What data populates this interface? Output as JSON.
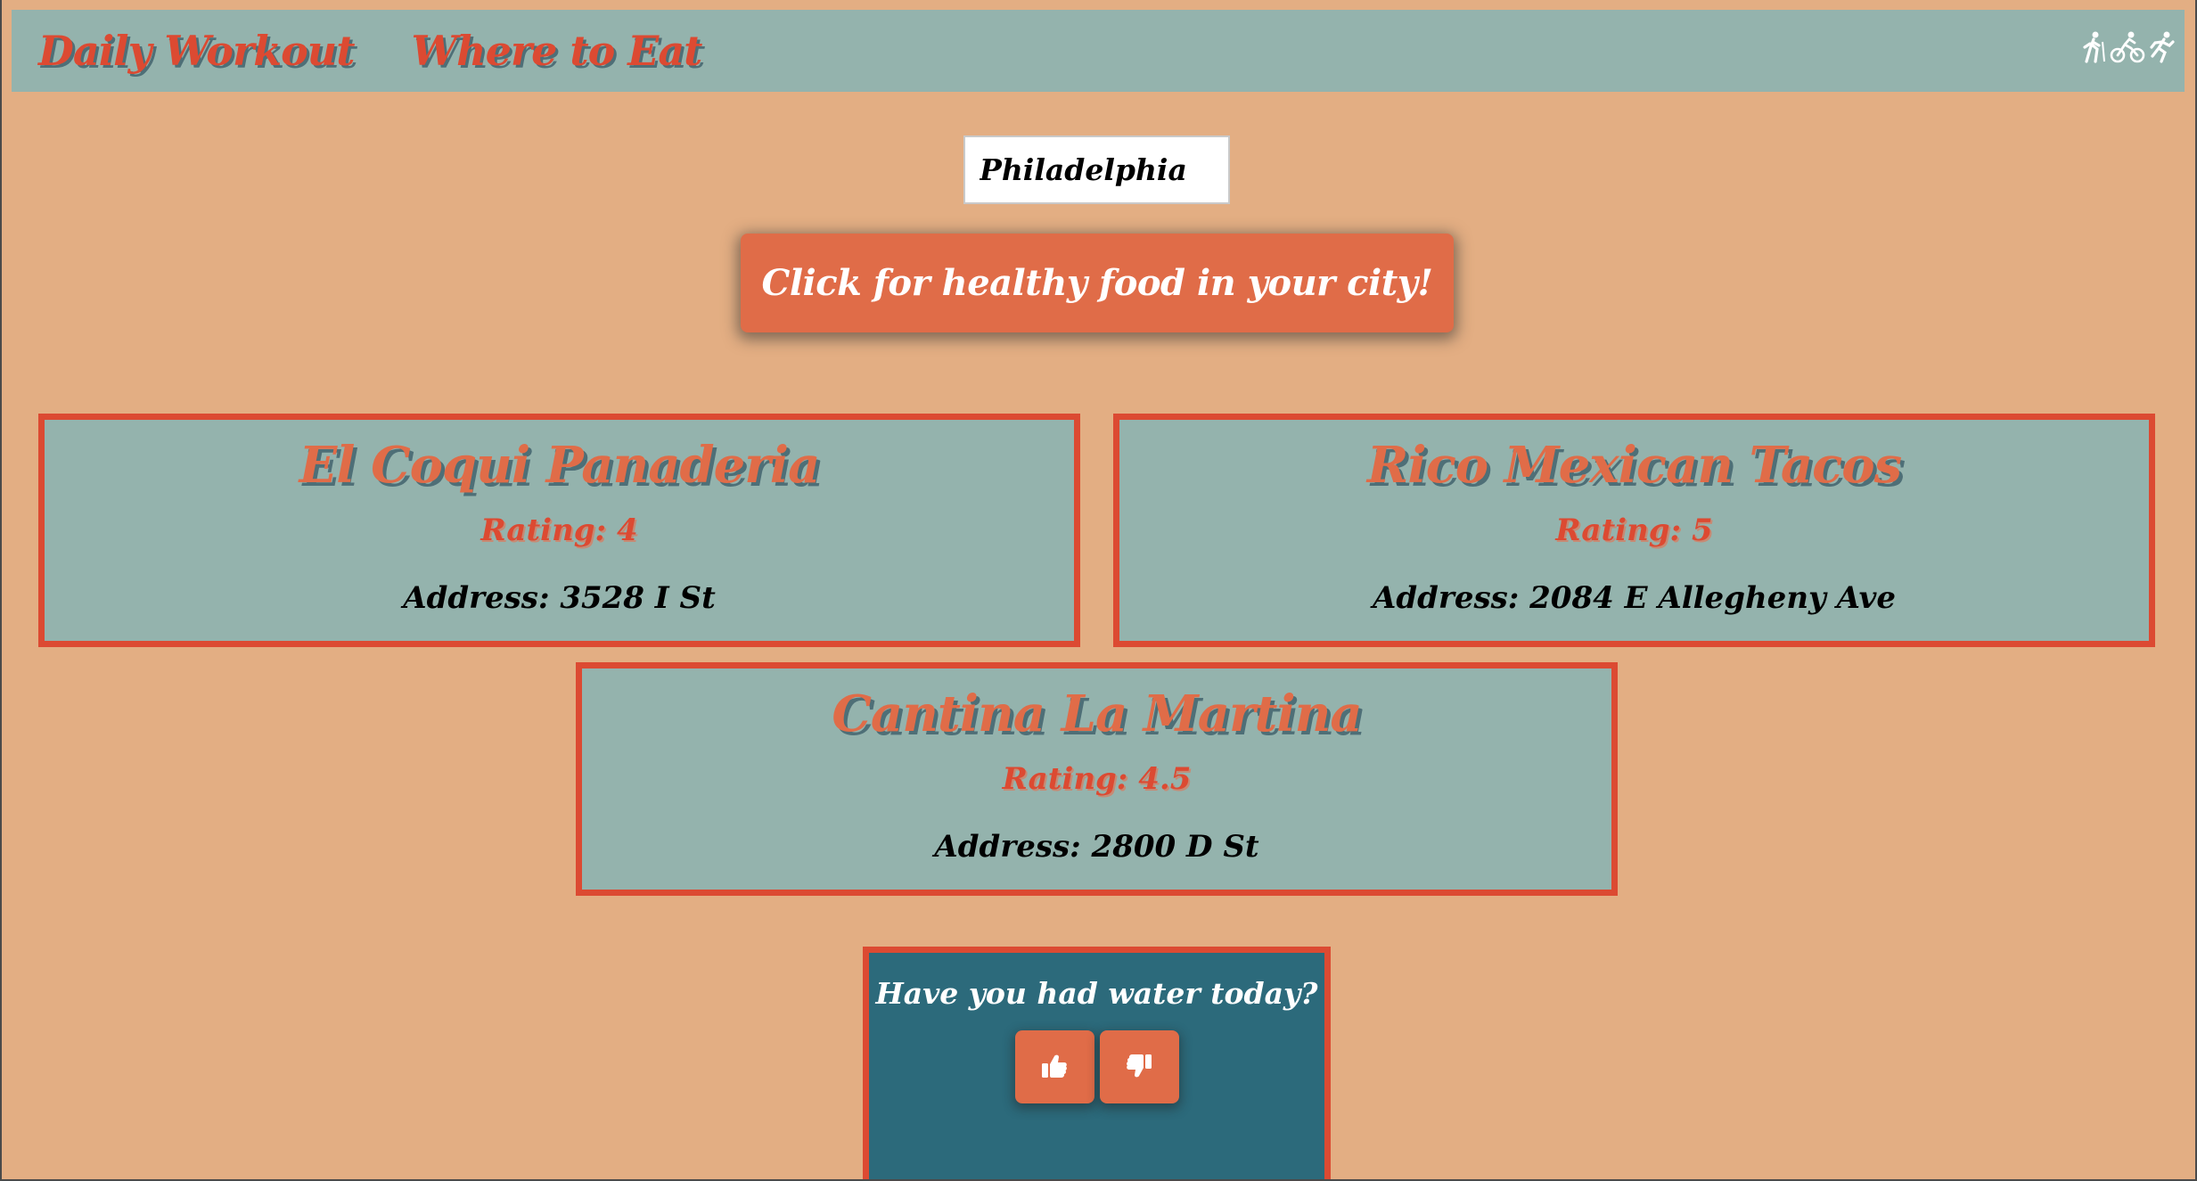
{
  "nav": {
    "links": [
      {
        "label": "Daily Workout"
      },
      {
        "label": "Where to Eat"
      }
    ],
    "icons": [
      "walking-icon",
      "biking-icon",
      "running-icon"
    ]
  },
  "search": {
    "city_value": "Philadelphia",
    "button_label": "Click for healthy food in your city!"
  },
  "restaurants": [
    {
      "name": "El Coqui Panaderia",
      "rating": "Rating: 4",
      "address": "Address: 3528 I St"
    },
    {
      "name": "Rico Mexican Tacos",
      "rating": "Rating: 5",
      "address": "Address: 2084 E Allegheny Ave"
    },
    {
      "name": "Cantina La Martina",
      "rating": "Rating: 4.5",
      "address": "Address: 2800 D St"
    }
  ],
  "water": {
    "question": "Have you had water today?",
    "yes_icon": "thumbs-up-icon",
    "no_icon": "thumbs-down-icon"
  },
  "colors": {
    "page_background": "#e3ae83",
    "panel": "#94b3ad",
    "accent_red": "#dc4a32",
    "button_orange": "#e06c48",
    "water_panel": "#2c6a7b"
  }
}
